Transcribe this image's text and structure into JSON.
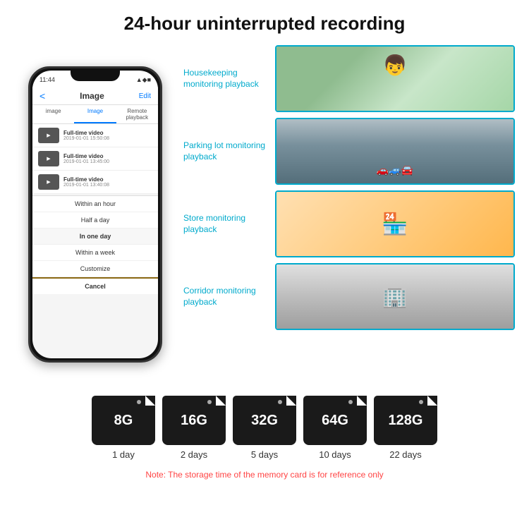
{
  "page": {
    "title": "24-hour uninterrupted recording"
  },
  "phone": {
    "status_time": "11:44",
    "nav_back": "<",
    "nav_title": "Image",
    "nav_edit": "Edit",
    "tabs": [
      "image",
      "Image",
      "Remote playback"
    ],
    "videos": [
      {
        "title": "Full-time video",
        "date": "2019-01-01 15:50:08"
      },
      {
        "title": "Full-time video",
        "date": "2019-01-01 13:45:00"
      },
      {
        "title": "Full-time video",
        "date": "2019-01-01 13:40:08"
      }
    ],
    "dropdown_items": [
      {
        "label": "Within an hour",
        "active": false
      },
      {
        "label": "Half a day",
        "active": false
      },
      {
        "label": "In one day",
        "active": true
      },
      {
        "label": "Within a week",
        "active": false
      },
      {
        "label": "Customize",
        "active": false
      }
    ],
    "cancel_label": "Cancel"
  },
  "monitoring": [
    {
      "label": "Housekeeping monitoring playback",
      "photo_type": "child"
    },
    {
      "label": "Parking lot monitoring playback",
      "photo_type": "parking"
    },
    {
      "label": "Store monitoring playback",
      "photo_type": "store"
    },
    {
      "label": "Corridor monitoring playback",
      "photo_type": "corridor"
    }
  ],
  "storage": {
    "cards": [
      {
        "size": "8G",
        "days": "1 day"
      },
      {
        "size": "16G",
        "days": "2 days"
      },
      {
        "size": "32G",
        "days": "5 days"
      },
      {
        "size": "64G",
        "days": "10 days"
      },
      {
        "size": "128G",
        "days": "22 days"
      }
    ],
    "note": "Note: The storage time of the memory card is for reference only"
  }
}
